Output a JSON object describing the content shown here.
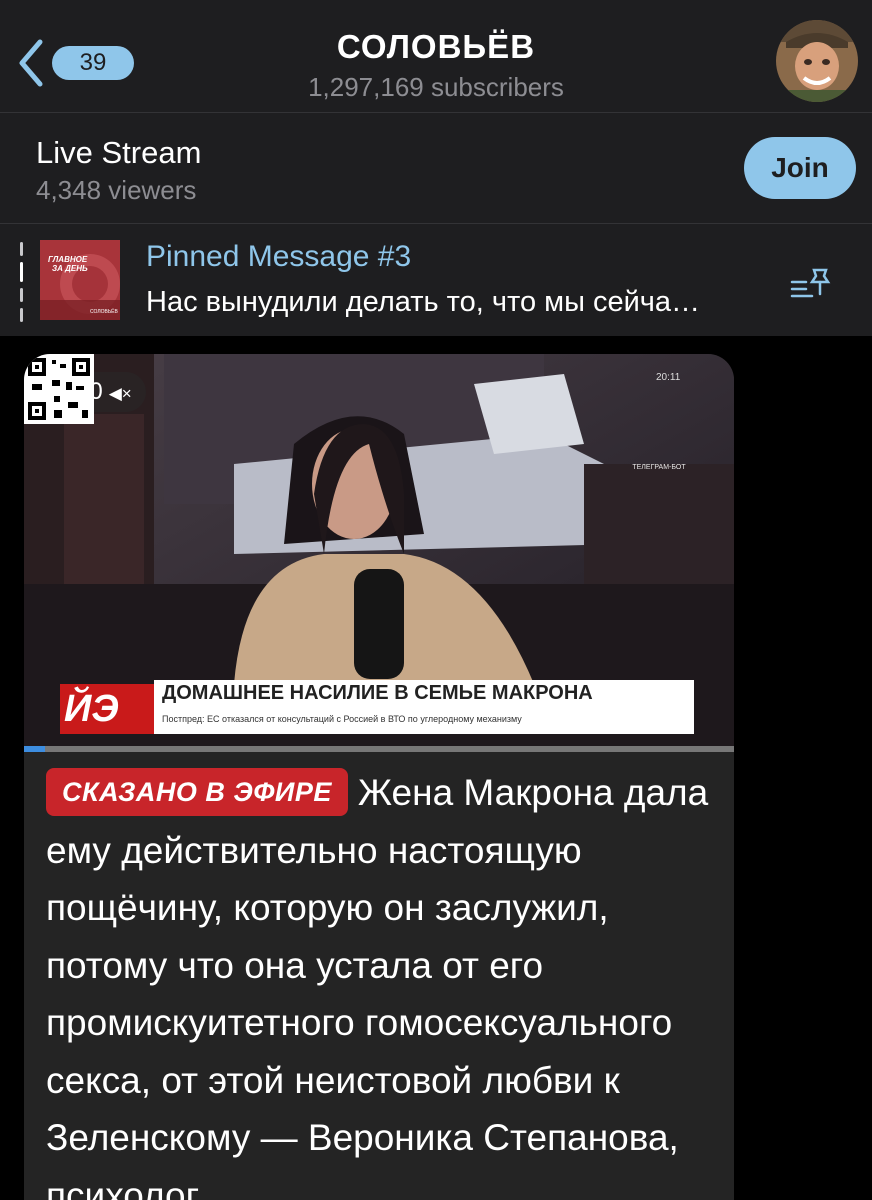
{
  "header": {
    "back_count": "39",
    "channel_title": "СОЛОВЬЁВ",
    "subscribers": "1,297,169 subscribers"
  },
  "live": {
    "title": "Live Stream",
    "viewers": "4,348 viewers",
    "join_label": "Join"
  },
  "pinned": {
    "title": "Pinned Message #3",
    "text": "Нас вынудили делать то, что мы сейча…",
    "thumb_text": "ГЛАВНОЕ ЗА ДЕНЬ",
    "thumb_brand": "СОЛОВЬЁВ"
  },
  "video": {
    "duration": "2:00",
    "muted_icon": "speaker-muted-icon",
    "clock": "20:11",
    "qr_label": "ТЕЛЕГРАМ-БОТ",
    "ticker_red": "ЙЭ",
    "ticker_headline": "ДОМАШНЕЕ НАСИЛИЕ В СЕМЬЕ МАКРОНА",
    "ticker_sub": "Постпред: ЕС отказался от консультаций с Россией в ВТО по углеродному механизму",
    "progress": 0.03
  },
  "message": {
    "tag": "СКАЗАНО В ЭФИРЕ",
    "text": "Жена Макрона дала ему действительно настоящую пощёчину, которую он заслужил, потому что она устала от его промискуитетного гомосексуального секса, от этой неистовой любви к Зеленскому — Вероника Степанова, психолог."
  },
  "colors": {
    "accent": "#8fc6ea",
    "background": "#000000",
    "panel": "#1e1e20",
    "tag_red": "#c8252a"
  }
}
